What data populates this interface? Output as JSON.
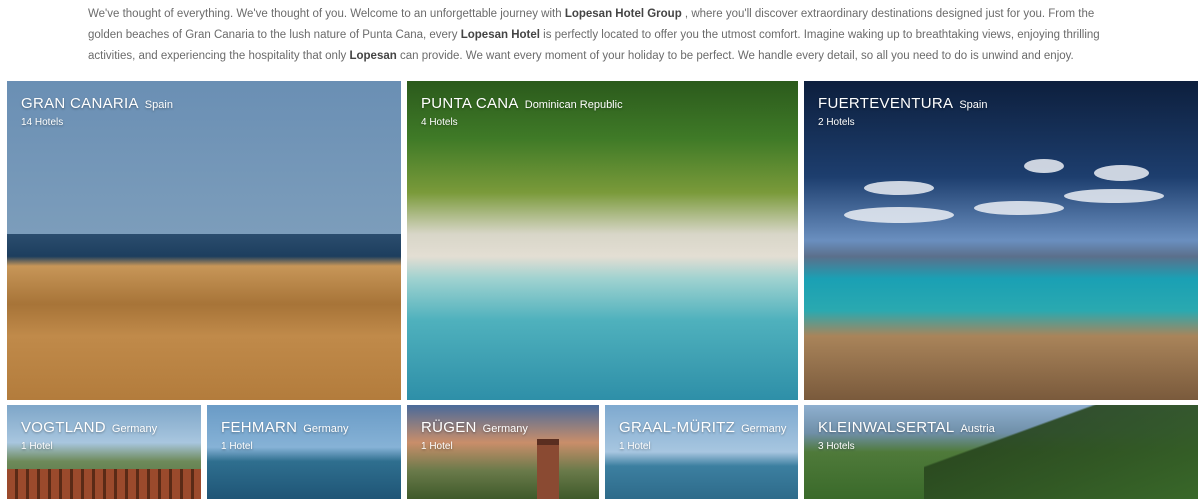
{
  "intro": {
    "p1": "We've thought of everything. We've thought of you. Welcome to an unforgettable journey with ",
    "b1": "Lopesan Hotel Group",
    "p2": " , where you'll discover extraordinary destinations designed just for you. From the golden beaches of Gran Canaria to the lush nature of Punta Cana, every ",
    "b2": "Lopesan Hotel",
    "p3": " is perfectly located to offer you the utmost comfort. Imagine waking up to breathtaking views, enjoying thrilling activities, and experiencing the hospitality that only ",
    "b3": "Lopesan",
    "p4": " can provide. We want every moment of your holiday to be perfect. We handle every detail, so all you need to do is unwind and enjoy."
  },
  "destinations": [
    {
      "name": "GRAN CANARIA",
      "country": "Spain",
      "count": "14 Hotels"
    },
    {
      "name": "PUNTA CANA",
      "country": "Dominican Republic",
      "count": "4 Hotels"
    },
    {
      "name": "FUERTEVENTURA",
      "country": "Spain",
      "count": "2 Hotels"
    },
    {
      "name": "VOGTLAND",
      "country": "Germany",
      "count": "1 Hotel"
    },
    {
      "name": "FEHMARN",
      "country": "Germany",
      "count": "1 Hotel"
    },
    {
      "name": "RÜGEN",
      "country": "Germany",
      "count": "1 Hotel"
    },
    {
      "name": "GRAAL-MÜRITZ",
      "country": "Germany",
      "count": "1 Hotel"
    },
    {
      "name": "KLEINWALSERTAL",
      "country": "Austria",
      "count": "3 Hotels"
    }
  ]
}
